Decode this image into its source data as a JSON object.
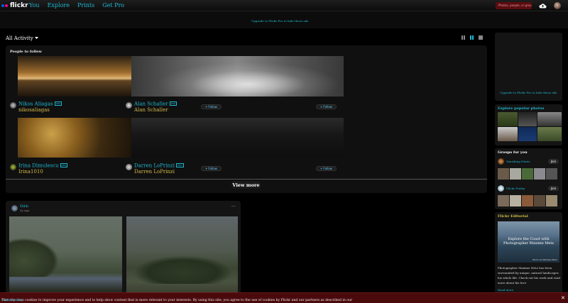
{
  "nav": {
    "logo": "flickr",
    "links": [
      "You",
      "Explore",
      "Prints",
      "Get Pro"
    ],
    "promo": "Photos, people, or grou",
    "brand_colors": {
      "pink": "#ff0084",
      "blue": "#0063dc",
      "link": "#1fb9d2"
    }
  },
  "ad_banner": "Upgrade to Flickr Pro to hide these ads",
  "feed": {
    "filter": "All Activity",
    "dropdown_icon": "chevron-down-icon"
  },
  "people_to_follow": {
    "title": "People to follow",
    "people": [
      {
        "name": "Nikos Aliagas",
        "pro": "PRO",
        "handle": "nikosaliagas",
        "follow": "Follow"
      },
      {
        "name": "Alan Schaller",
        "pro": "PRO",
        "handle": "Alan Schaller",
        "follow": "Follow"
      },
      {
        "name": "Irina Dimulescu",
        "pro": "PRO",
        "handle": "Irina1010",
        "follow": "Follow"
      },
      {
        "name": "Darren LoPrinzi",
        "pro": "PRO",
        "handle": "Darren LoPrinzi",
        "follow": "Follow"
      }
    ],
    "view_more": "View more"
  },
  "post": {
    "user": "Dibb",
    "time": "5y ago",
    "more": "···"
  },
  "sidebar": {
    "ad": "Upgrade to Flickr Pro to hide these ads",
    "explore_title": "Explore popular photos",
    "groups_title": "Groups for you",
    "groups": [
      {
        "name": "Vanishing Points",
        "join": "Join"
      },
      {
        "name": "Flickr Friday",
        "join": "Join"
      }
    ],
    "editorial_title": "Flickr Editorial",
    "editorial_caption": "Explore the Coast with Photographer Maxime Metz",
    "editorial_credit": "Photo by Maxime Metz",
    "editorial_text": "Photographer Maxime Metz has been surrounded by unique, natural landscapes his whole life. Check out his work and read more about his love",
    "editorial_more": "Read more"
  },
  "cookie": {
    "text": "This site uses cookies to improve your experience and to help show content that is more relevant to your interests. By using this site, you agree to the use of cookies by Flickr and our partners as described in our",
    "policy": "cookie policy",
    "close": "✕"
  }
}
